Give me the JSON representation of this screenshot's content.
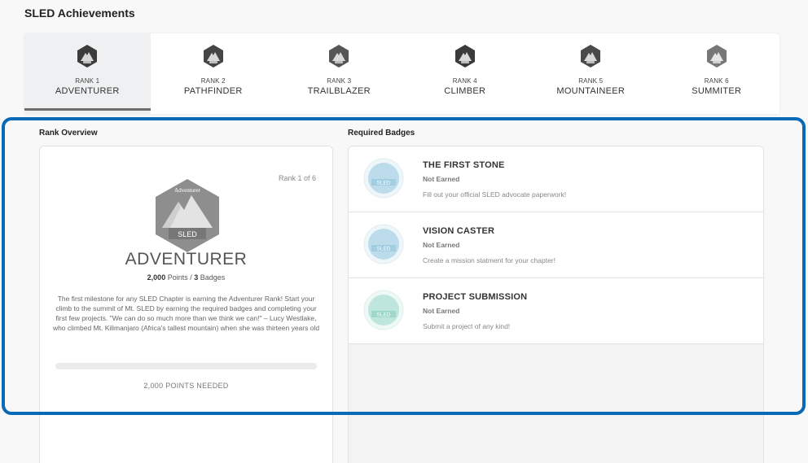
{
  "page": {
    "title": "SLED Achievements"
  },
  "ranks": [
    {
      "number": "RANK 1",
      "name": "ADVENTURER",
      "active": true
    },
    {
      "number": "RANK 2",
      "name": "PATHFINDER",
      "active": false
    },
    {
      "number": "RANK 3",
      "name": "TRAILBLAZER",
      "active": false
    },
    {
      "number": "RANK 4",
      "name": "CLIMBER",
      "active": false
    },
    {
      "number": "RANK 5",
      "name": "MOUNTAINEER",
      "active": false
    },
    {
      "number": "RANK 6",
      "name": "SUMMITER",
      "active": false
    }
  ],
  "overview": {
    "label": "Rank Overview",
    "rank_of": "Rank 1 of 6",
    "badge_top_text": "Adventurer",
    "badge_text": "SLED",
    "name": "ADVENTURER",
    "points": "2,000",
    "points_word": "Points /",
    "badges_count": "3",
    "badges_word": "Badges",
    "description": "The first milestone for any SLED Chapter is earning the Adventurer Rank! Start your climb to the summit of Mt. SLED by earning the required badges and completing your first few projects. \"We can do so much more than we think we can!\" – Lucy Westlake, who climbed Mt. Kilimanjaro (Africa's tallest mountain) when she was thirteen years old",
    "progress_percent": 0,
    "points_needed": "2,000 POINTS NEEDED"
  },
  "required_badges": {
    "label": "Required Badges",
    "items": [
      {
        "title": "THE FIRST STONE",
        "status": "Not Earned",
        "description": "Fill out your official SLED advocate paperwork!",
        "color": "#bcdcec",
        "badge_text": "SLED"
      },
      {
        "title": "VISION CASTER",
        "status": "Not Earned",
        "description": "Create a mission statment for your chapter!",
        "color": "#bcdcec",
        "badge_text": "SLED"
      },
      {
        "title": "PROJECT SUBMISSION",
        "status": "Not Earned",
        "description": "Submit a project of any kind!",
        "color": "#bfe6dc",
        "badge_text": "SLED"
      }
    ]
  },
  "colors": {
    "highlight": "#0a69b5",
    "active_tab": "#eef0f1",
    "active_underline": "#6d6d6d"
  }
}
